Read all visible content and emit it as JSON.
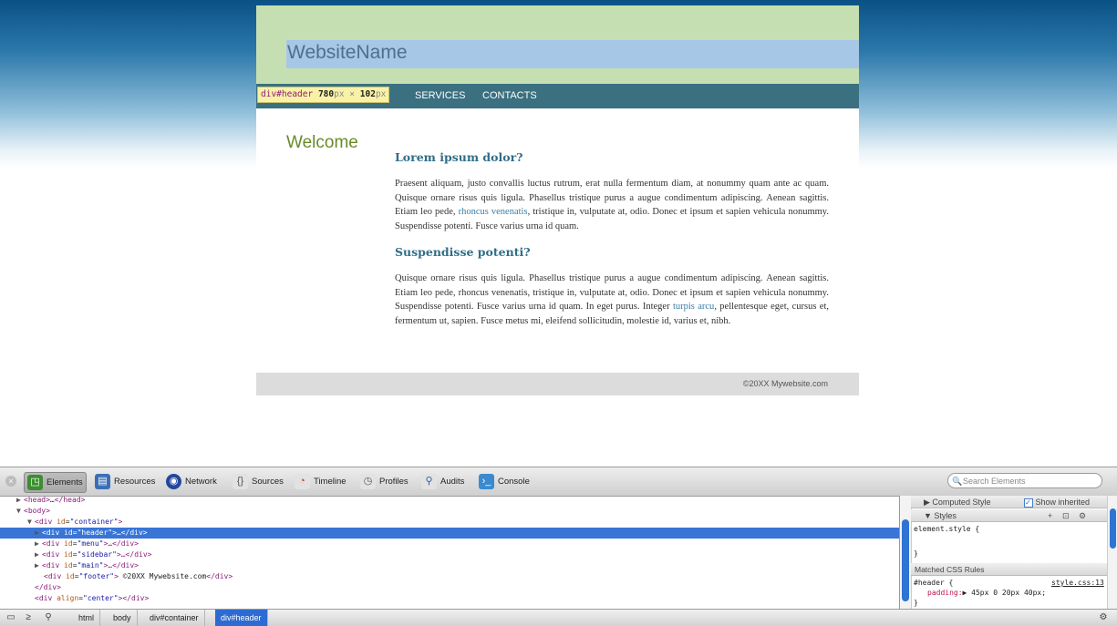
{
  "page": {
    "site_name": "WebsiteName",
    "nav": [
      "SERVICES",
      "CONTACTS"
    ],
    "header_tooltip": {
      "selector": "div#header",
      "width": "780",
      "height": "102",
      "unit": "px",
      "sep": "×"
    },
    "welcome": "Welcome",
    "sections": [
      {
        "heading": "Lorem ipsum dolor?",
        "text_before": "Praesent aliquam, justo convallis luctus rutrum, erat nulla fermentum diam, at nonummy quam ante ac quam. Quisque ornare risus quis ligula. Phasellus tristique purus a augue condimentum adipiscing. Aenean sagittis. Etiam leo pede, ",
        "link": "rhoncus venenatis",
        "text_after": ", tristique in, vulputate at, odio. Donec et ipsum et sapien vehicula nonummy. Suspendisse potenti. Fusce varius urna id quam."
      },
      {
        "heading": "Suspendisse potenti?",
        "text_before": "Quisque ornare risus quis ligula. Phasellus tristique purus a augue condimentum adipiscing. Aenean sagittis. Etiam leo pede, rhoncus venenatis, tristique in, vulputate at, odio. Donec et ipsum et sapien vehicula nonummy. Suspendisse potenti. Fusce varius urna id quam. In eget purus. Integer ",
        "link": "turpis arcu",
        "text_after": ", pellentesque eget, cursus et, fermentum ut, sapien. Fusce metus mi, eleifend sollicitudin, molestie id, varius et, nibh."
      }
    ],
    "footer": "©20XX Mywebsite.com"
  },
  "devtools": {
    "tabs": [
      {
        "label": "Elements",
        "icon": "elements-icon",
        "color": "#3c8f2f"
      },
      {
        "label": "Resources",
        "icon": "resources-icon",
        "color": "#3b6fb5"
      },
      {
        "label": "Network",
        "icon": "network-icon",
        "color": "#24469c"
      },
      {
        "label": "Sources",
        "icon": "sources-icon",
        "color": "#888888"
      },
      {
        "label": "Timeline",
        "icon": "timeline-icon",
        "color": "#c53a2a"
      },
      {
        "label": "Profiles",
        "icon": "profiles-icon",
        "color": "#888888"
      },
      {
        "label": "Audits",
        "icon": "audits-icon",
        "color": "#2d5fa8"
      },
      {
        "label": "Console",
        "icon": "console-icon",
        "color": "#d18a1c"
      }
    ],
    "search_placeholder": "Search Elements",
    "tree": [
      {
        "tri": "▶",
        "tag_open": "<head>",
        "mid": "…",
        "tag_close": "</head>"
      },
      {
        "tri": "▼",
        "tag_open": "<body>"
      },
      {
        "tri": "▼",
        "tag_open": "<div ",
        "attr": "id",
        "val": "\"container\"",
        "tag_end": ">"
      },
      {
        "tri": "▶",
        "tag_open": "<div ",
        "attr": "id",
        "val": "\"header\"",
        "tag_end": ">…</div>"
      },
      {
        "tri": "▶",
        "tag_open": "<div ",
        "attr": "id",
        "val": "\"menu\"",
        "tag_end": ">…</div>"
      },
      {
        "tri": "▶",
        "tag_open": "<div ",
        "attr": "id",
        "val": "\"sidebar\"",
        "tag_end": ">…</div>"
      },
      {
        "tri": "▶",
        "tag_open": "<div ",
        "attr": "id",
        "val": "\"main\"",
        "tag_end": ">…</div>"
      },
      {
        "tri": "",
        "tag_open": "<div ",
        "attr": "id",
        "val": "\"footer\"",
        "tag_end": ">",
        "text": " ©20XX Mywebsite.com",
        "close": "</div>"
      },
      {
        "tri": "",
        "tag_open": "</div>"
      },
      {
        "tri": "",
        "tag_open": "<div ",
        "attr": "align",
        "val": "\"center\"",
        "tag_end": "></div>"
      }
    ],
    "sidebar": {
      "computed_label": "Computed Style",
      "show_inherited": "Show inherited",
      "styles_label": "Styles",
      "element_style_open": "element.style {",
      "element_style_close": "}",
      "matched_label": "Matched CSS Rules",
      "rule_selector": "#header {",
      "rule_source": "style.css:13",
      "rule_prop": "padding:",
      "rule_value": "▶ 45px 0 20px 40px;",
      "rule_close": "}"
    },
    "breadcrumbs": [
      "html",
      "body",
      "div#container",
      "div#header"
    ]
  }
}
